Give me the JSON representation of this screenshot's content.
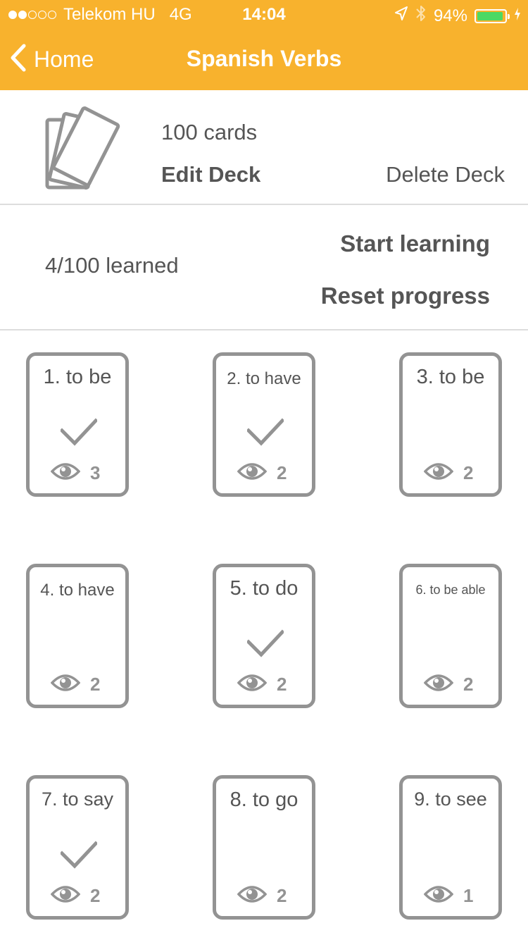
{
  "status_bar": {
    "carrier": "Telekom HU",
    "network": "4G",
    "time": "14:04",
    "battery": "94%",
    "battery_level": 0.94,
    "signal_bars_filled": 2,
    "signal_bars_total": 5
  },
  "nav": {
    "back_label": "Home",
    "title": "Spanish Verbs"
  },
  "deck": {
    "card_count": "100 cards",
    "edit_label": "Edit Deck",
    "delete_label": "Delete Deck"
  },
  "progress": {
    "learned": "4/100 learned",
    "start_label": "Start learning",
    "reset_label": "Reset progress"
  },
  "cards": [
    {
      "title": "1. to be",
      "learned": true,
      "views": "3",
      "font": 29
    },
    {
      "title": "2. to have",
      "learned": true,
      "views": "2",
      "font": 24
    },
    {
      "title": "3. to be",
      "learned": false,
      "views": "2",
      "font": 29
    },
    {
      "title": "4. to have",
      "learned": false,
      "views": "2",
      "font": 24
    },
    {
      "title": "5. to do",
      "learned": true,
      "views": "2",
      "font": 29
    },
    {
      "title": "6. to be able",
      "learned": false,
      "views": "2",
      "font": 18
    },
    {
      "title": "7. to say",
      "learned": true,
      "views": "2",
      "font": 27
    },
    {
      "title": "8. to go",
      "learned": false,
      "views": "2",
      "font": 29
    },
    {
      "title": "9. to see",
      "learned": false,
      "views": "1",
      "font": 27
    }
  ],
  "colors": {
    "accent": "#f8b22d",
    "card_border": "#939393",
    "text": "#555555",
    "battery_fill": "#4cd964"
  }
}
